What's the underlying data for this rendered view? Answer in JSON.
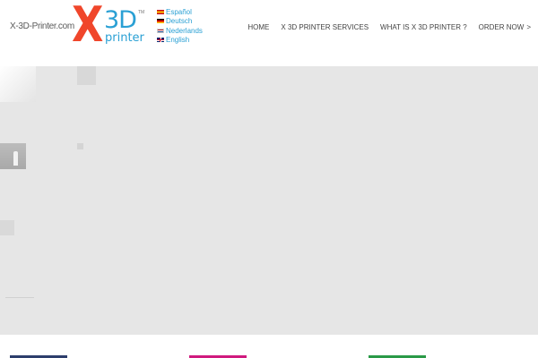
{
  "header": {
    "site_name": "X-3D-Printer.com",
    "logo": {
      "x": "X",
      "three_d": "3D",
      "printer": "printer",
      "tm": "TM"
    },
    "languages": [
      {
        "label": "Español",
        "flag": "spain-flag-icon"
      },
      {
        "label": "Deutsch",
        "flag": "germany-flag-icon"
      },
      {
        "label": "Nederlands",
        "flag": "netherlands-flag-icon"
      },
      {
        "label": "English",
        "flag": "uk-flag-icon"
      }
    ],
    "nav": {
      "home": "HOME",
      "services": "X 3D PRINTER SERVICES",
      "what_is": "WHAT IS X 3D PRINTER ?",
      "order_now": "ORDER NOW",
      "order_arrow": ">"
    }
  },
  "colors": {
    "brand_orange": "#f0462b",
    "brand_blue": "#2aa0d4",
    "hero_background": "#e6e6e6",
    "feature_blue": "#2d3e6c",
    "feature_pink": "#d01a7e",
    "feature_green": "#2a9a47"
  }
}
